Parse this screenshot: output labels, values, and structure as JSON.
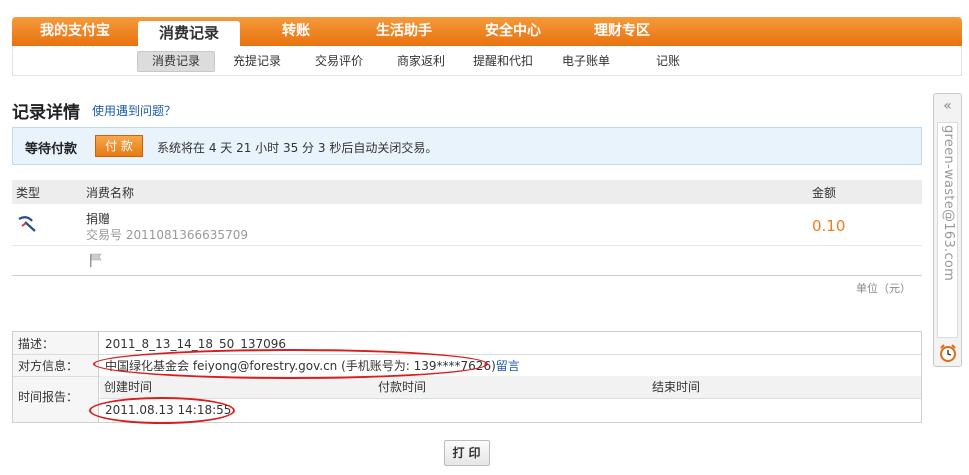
{
  "topnav": {
    "tabs": [
      {
        "label": "我的支付宝"
      },
      {
        "label": "消费记录"
      },
      {
        "label": "转账"
      },
      {
        "label": "生活助手"
      },
      {
        "label": "安全中心"
      },
      {
        "label": "理财专区"
      }
    ],
    "active": "消费记录"
  },
  "subnav": {
    "items": [
      {
        "label": "消费记录"
      },
      {
        "label": "充提记录"
      },
      {
        "label": "交易评价"
      },
      {
        "label": "商家返利"
      },
      {
        "label": "提醒和代扣"
      },
      {
        "label": "电子账单"
      },
      {
        "label": "记账"
      }
    ],
    "active": "消费记录"
  },
  "page": {
    "title": "记录详情",
    "help_link": "使用遇到问题？"
  },
  "status": {
    "title": "等待付款",
    "pay_button": "付 款",
    "message": "系统将在 4 天 21 小时 35 分 3 秒后自动关闭交易。"
  },
  "record_table": {
    "headers": {
      "type": "类型",
      "name": "消费名称",
      "amount": "金额"
    },
    "row": {
      "name": "捐赠",
      "trade_no": "交易号 2011081366635709",
      "amount": "0.10"
    },
    "unit": "单位（元）"
  },
  "details": {
    "desc_label": "描述：",
    "desc_value": "2011_8_13_14_18_50_137096",
    "counterparty_label": "对方信息：",
    "counterparty_value": "中国绿化基金会 feiyong@forestry.gov.cn (手机账号为: 139****7626)",
    "leave_message": "留言",
    "time_label": "时间报告：",
    "time_headers": {
      "created": "创建时间",
      "paid": "付款时间",
      "closed": "结束时间"
    },
    "created_value": "2011.08.13 14:18:55"
  },
  "print_button": "打印",
  "side_widget": {
    "collapse": "«",
    "email": "green-waste@163.com"
  },
  "colors": {
    "nav_orange": "#e8720e",
    "amount_orange": "#f07b1e",
    "highlight_red": "#d81e1e",
    "link_blue": "#1e5aa8"
  }
}
